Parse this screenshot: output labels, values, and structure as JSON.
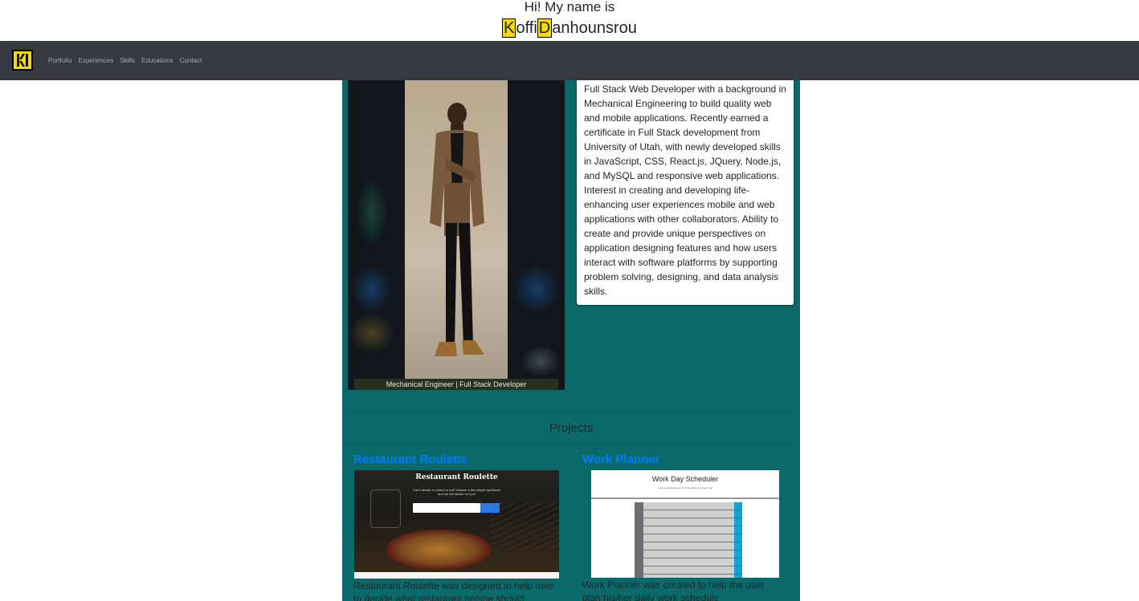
{
  "header": {
    "greeting": "Hi! My name is",
    "first_initial": "K",
    "first_rest": "offi",
    "last_initial": "D",
    "last_rest": "anhounsrou"
  },
  "navbar": {
    "logo_icon": "kd-logo-icon",
    "links": [
      "Portfolio",
      "Experiences",
      "Skills",
      "Educations",
      "Contact"
    ]
  },
  "profile": {
    "photo_caption": "Mechanical Engineer | Full Stack Developer",
    "about": "Full Stack Web Developer with a background in Mechanical Engineering to build quality web and mobile applications. Recently earned a certificate in Full Stack development from University of Utah, with newly developed skills in JavaScript, CSS, React.js, JQuery, Node.js, and MySQL and responsive web applications. Interest in creating and developing life-enhancing user experiences mobile and web applications with other collaborators. Ability to create and provide unique perspectives on application designing features and how users interact with software platforms by supporting problem solving, designing, and data analysis skills."
  },
  "projects": {
    "title": "Projects",
    "items": [
      {
        "title": "Restaurant Roulette",
        "screenshot_title": "Restaurant Roulette",
        "screenshot_subtitle": "Can't decide on where to eat? Answer a few simple questions and we will decide for you!",
        "description": "Restaurant Roulette was designed to help user to decide what restaurant he/she should"
      },
      {
        "title": "Work Planner",
        "screenshot_title": "Work Day Scheduler",
        "screenshot_subtitle": "A simple calendar app for scheduling your work day",
        "description": "Work Planner was created to help the user plan his/her daily work schedule"
      }
    ]
  },
  "colors": {
    "accent_yellow": "#f5d90a",
    "navbar_bg": "#343a40",
    "main_bg": "#0a6a6a",
    "link_blue": "#007bff"
  }
}
